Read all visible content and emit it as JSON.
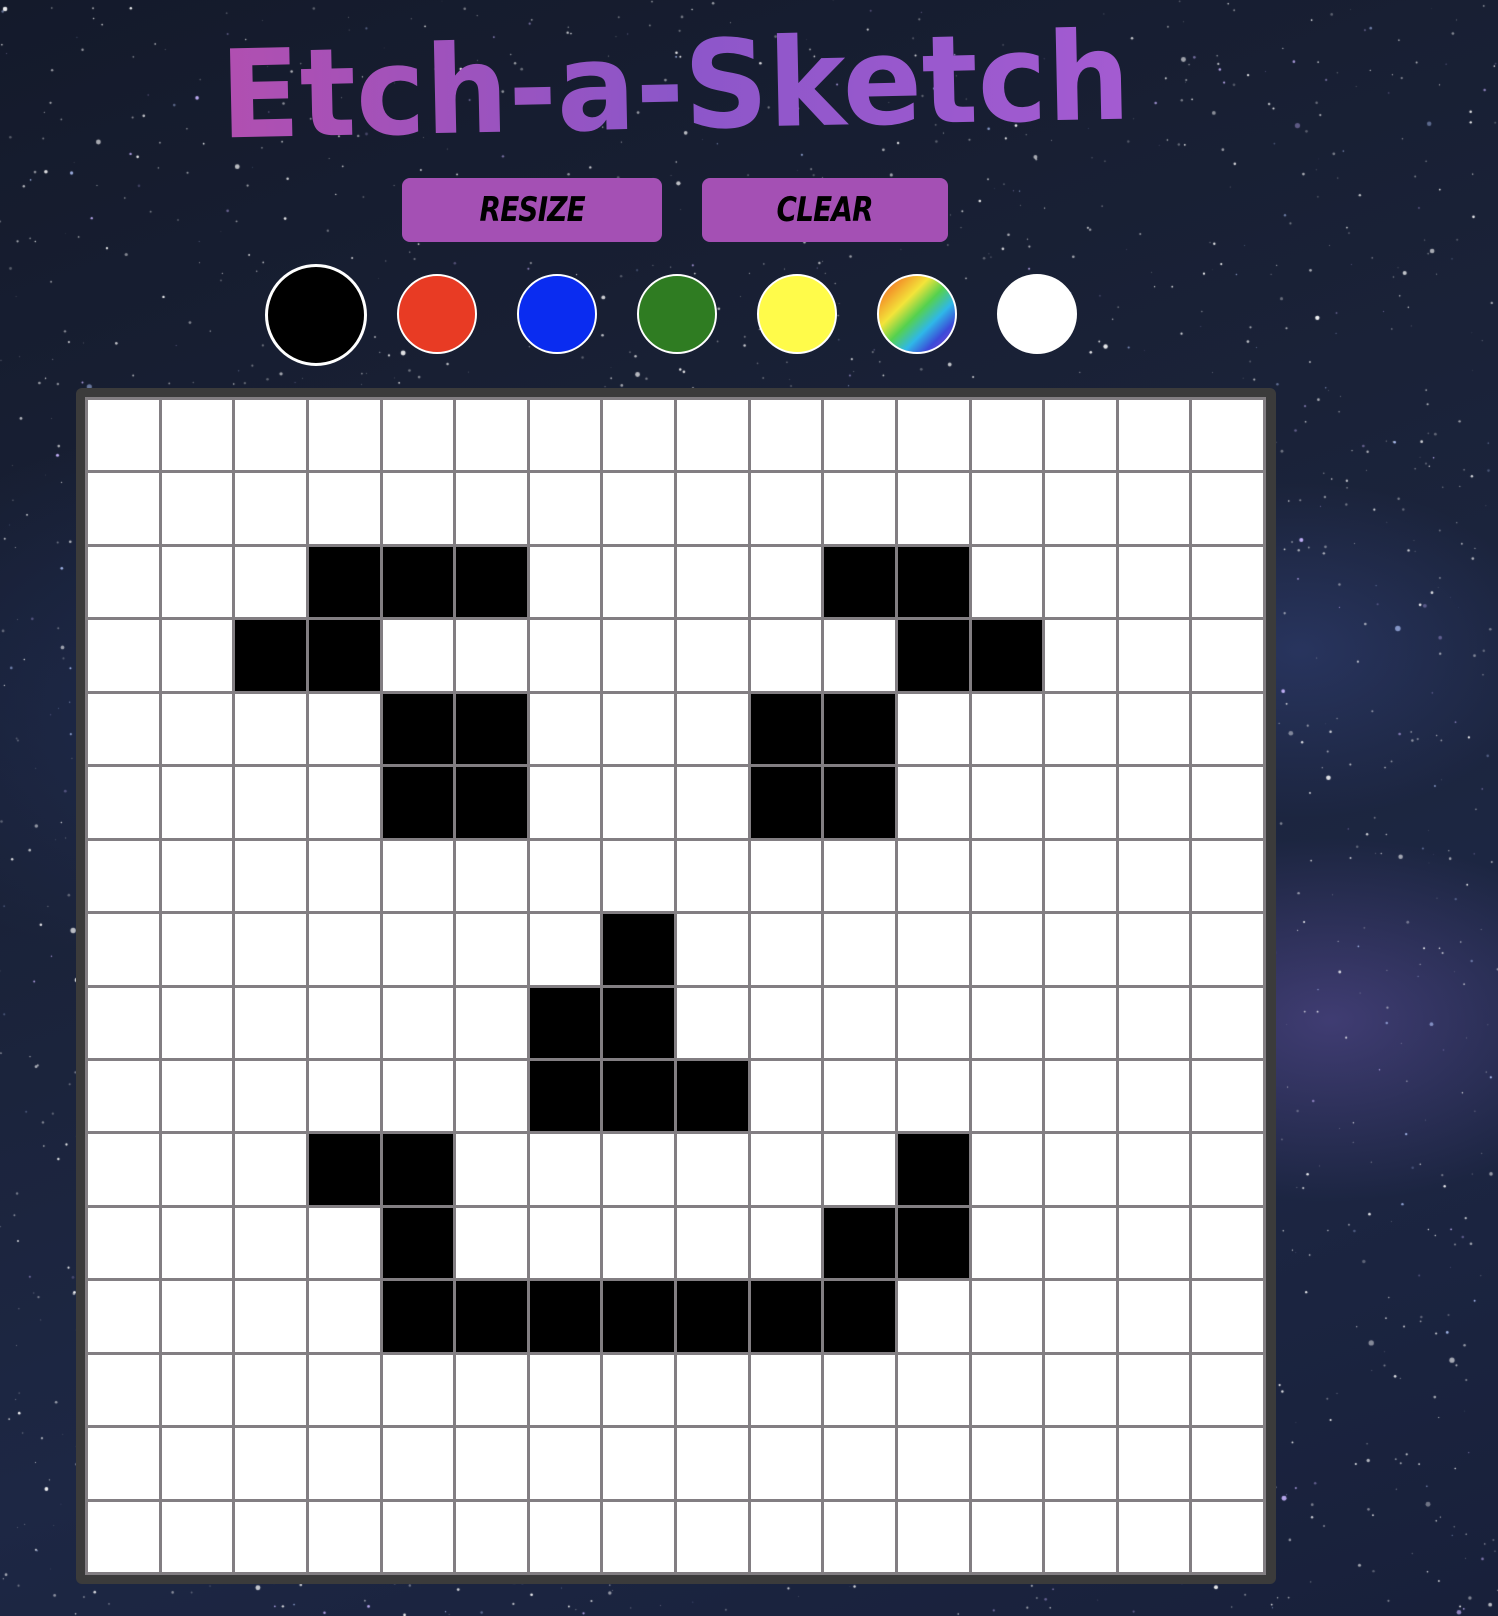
{
  "app": {
    "title": "Etch-a-Sketch"
  },
  "controls": {
    "resize_label": "RESIZE",
    "clear_label": "CLEAR"
  },
  "colors": {
    "title_gradient": [
      "#b14fb0",
      "#8c56c9",
      "#a45bd1"
    ],
    "button_bg": "#a450b4",
    "palette": [
      {
        "name": "black",
        "value": "#000000",
        "selected": true
      },
      {
        "name": "red",
        "value": "#e83b24",
        "selected": false
      },
      {
        "name": "blue",
        "value": "#0a2cf0",
        "selected": false
      },
      {
        "name": "green",
        "value": "#2f7c22",
        "selected": false
      },
      {
        "name": "yellow",
        "value": "#fffb4a",
        "selected": false
      },
      {
        "name": "rainbow",
        "value": "rainbow",
        "selected": false
      },
      {
        "name": "white",
        "value": "#ffffff",
        "selected": false
      }
    ],
    "grid_line": "#827e82",
    "board_frame": "#3b3b3b",
    "cell_empty": "#ffffff",
    "cell_filled": "#000000"
  },
  "board": {
    "size": 16,
    "filled_cells": [
      [
        2,
        3
      ],
      [
        2,
        4
      ],
      [
        2,
        5
      ],
      [
        2,
        10
      ],
      [
        2,
        11
      ],
      [
        3,
        2
      ],
      [
        3,
        3
      ],
      [
        3,
        11
      ],
      [
        3,
        12
      ],
      [
        4,
        4
      ],
      [
        4,
        5
      ],
      [
        4,
        9
      ],
      [
        4,
        10
      ],
      [
        5,
        4
      ],
      [
        5,
        5
      ],
      [
        5,
        9
      ],
      [
        5,
        10
      ],
      [
        7,
        7
      ],
      [
        8,
        6
      ],
      [
        8,
        7
      ],
      [
        9,
        6
      ],
      [
        9,
        7
      ],
      [
        9,
        8
      ],
      [
        10,
        3
      ],
      [
        10,
        4
      ],
      [
        10,
        11
      ],
      [
        11,
        4
      ],
      [
        11,
        10
      ],
      [
        11,
        11
      ],
      [
        12,
        4
      ],
      [
        12,
        5
      ],
      [
        12,
        6
      ],
      [
        12,
        7
      ],
      [
        12,
        8
      ],
      [
        12,
        9
      ],
      [
        12,
        10
      ]
    ]
  }
}
